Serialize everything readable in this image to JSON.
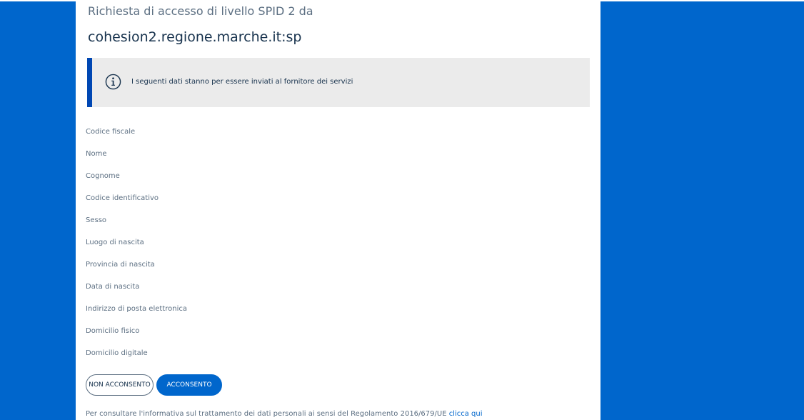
{
  "header": {
    "subtitle": "Richiesta di accesso di livello SPID 2 da",
    "service_provider": "cohesion2.regione.marche.it:sp"
  },
  "callout": {
    "icon": "info-icon",
    "text": "I seguenti dati stanno per essere inviati al fornitore dei servizi"
  },
  "attributes": [
    "Codice fiscale",
    "Nome",
    "Cognome",
    "Codice identificativo",
    "Sesso",
    "Luogo di nascita",
    "Provincia di nascita",
    "Data di nascita",
    "Indirizzo di posta elettronica",
    "Domicilio fisico",
    "Domicilio digitale"
  ],
  "actions": {
    "deny_label": "NON ACCONSENTO",
    "accept_label": "ACCONSENTO"
  },
  "footer": {
    "text": "Per consultare l'informativa sul trattamento dei dati personali ai sensi del Regolamento 2016/679/UE ",
    "link_label": "clicca qui"
  },
  "colors": {
    "background": "#0066cc",
    "panel": "#ffffff",
    "callout_bg": "#ebebeb",
    "callout_border": "#0047b3",
    "primary": "#0066cc",
    "text_dark": "#17324d",
    "text_muted": "#5c6f82"
  }
}
